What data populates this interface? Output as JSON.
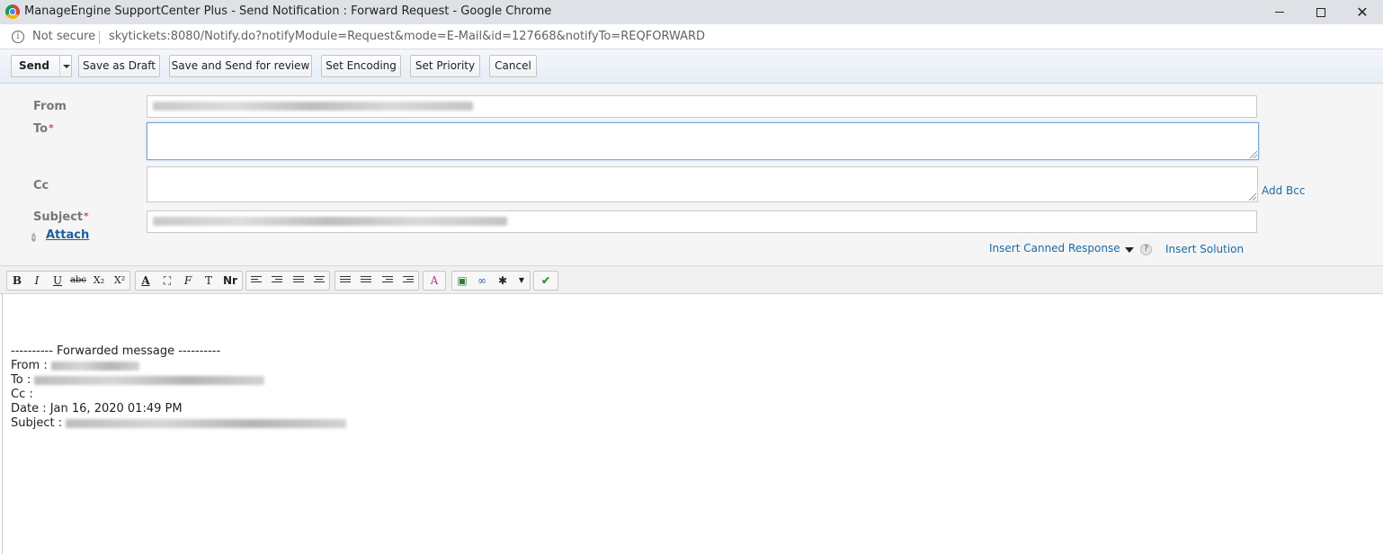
{
  "window": {
    "title": "ManageEngine SupportCenter Plus - Send Notification : Forward Request - Google Chrome",
    "minimize_glyph": "",
    "maximize_glyph": "",
    "close_glyph": "✕"
  },
  "address": {
    "security": "Not secure",
    "url": "skytickets:8080/Notify.do?notifyModule=Request&mode=E-Mail&id=127668&notifyTo=REQFORWARD"
  },
  "toolbar": {
    "send": "Send",
    "save_draft": "Save as Draft",
    "save_review": "Save and Send for review",
    "set_encoding": "Set Encoding",
    "set_priority": "Set Priority",
    "cancel": "Cancel"
  },
  "form": {
    "from_label": "From",
    "to_label": "To",
    "cc_label": "Cc",
    "subject_label": "Subject",
    "required_mark": "*",
    "attach": "Attach",
    "add_bcc": "Add Bcc",
    "insert_canned": "Insert Canned Response",
    "help": "?",
    "insert_solution": "Insert Solution",
    "to_value": "",
    "cc_value": ""
  },
  "editor_toolbar": {
    "bold": "B",
    "italic": "I",
    "underline": "U",
    "strike": "abc",
    "subscript": "X₂",
    "superscript": "X²",
    "font_color": "A",
    "font_size": "Nr"
  },
  "editor": {
    "forwarded_header": "---------- Forwarded message ----------",
    "from_line": "From :",
    "to_line": "To :",
    "cc_line": "Cc :",
    "date_line": "Date : Jan 16, 2020 01:49 PM",
    "subject_line": "Subject :"
  },
  "icons": {
    "info": "info-icon",
    "attach": "paperclip-icon",
    "spell": "spellcheck-icon"
  }
}
